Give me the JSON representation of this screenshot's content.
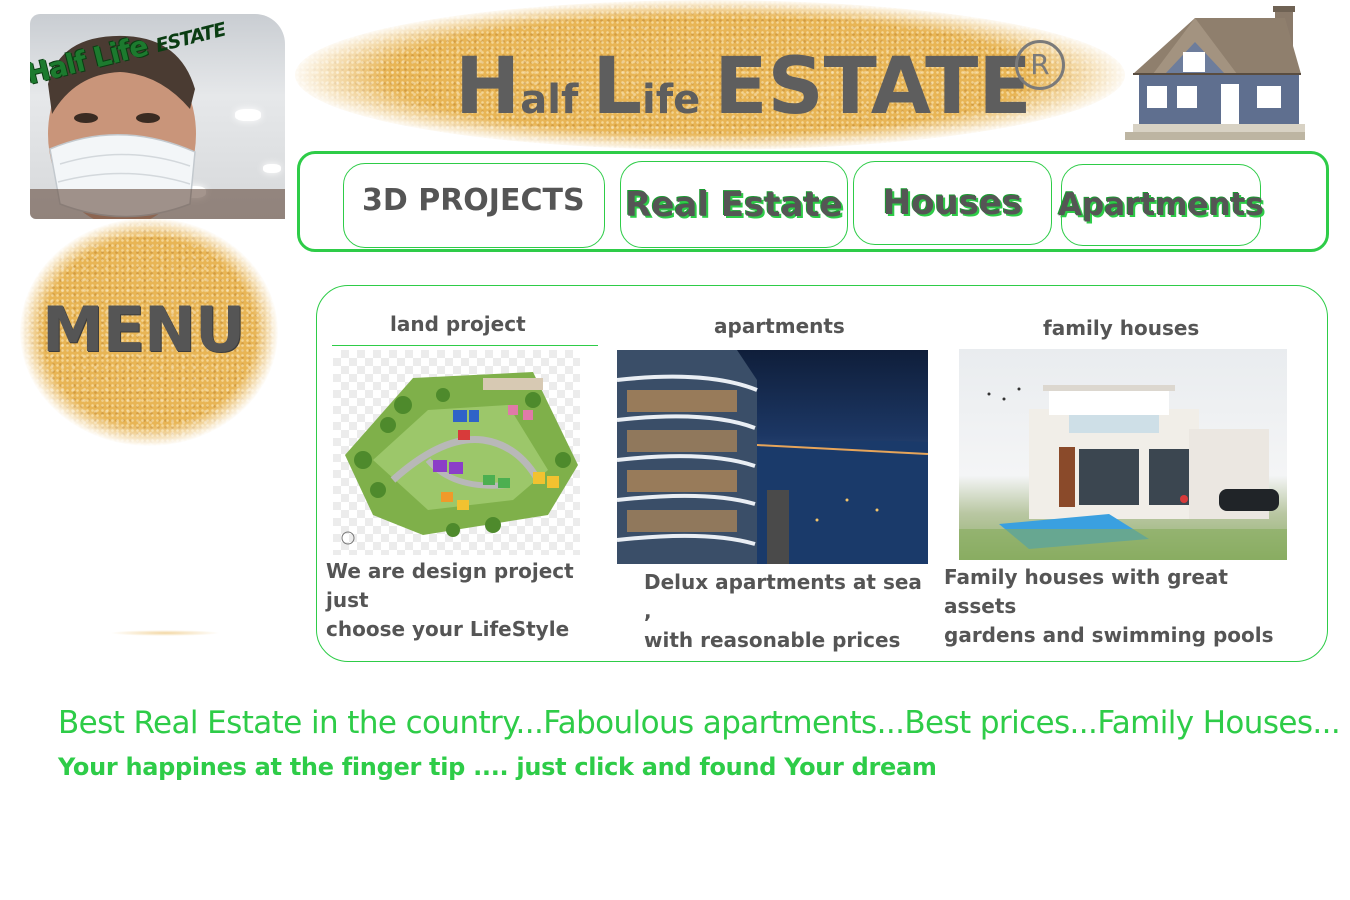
{
  "brand": {
    "avatar_text_main": "Half Life",
    "avatar_text_small": "ESTATE",
    "title_h": "H",
    "title_alf": "alf ",
    "title_l": "L",
    "title_ife": "ife ",
    "title_estate": "ESTATE",
    "registered_symbol": "R"
  },
  "nav": {
    "items": [
      {
        "label": "3D PROJECTS"
      },
      {
        "label": "Real Estate"
      },
      {
        "label": "Houses"
      },
      {
        "label": "Apartments"
      }
    ]
  },
  "sidebar": {
    "menu_label": "MENU"
  },
  "cards": [
    {
      "title": "land project",
      "desc_line1": "We are design project just",
      "desc_line2": "choose your LifeStyle"
    },
    {
      "title": "apartments",
      "desc_line1": "Delux apartments at sea ,",
      "desc_line2": "with reasonable prices"
    },
    {
      "title": "family houses",
      "desc_line1": "Family houses with great assets",
      "desc_line2": "gardens and swimming pools"
    }
  ],
  "footer": {
    "tagline": "Best Real Estate in the country...Faboulous apartments...Best prices...Family Houses...",
    "subtagline": "Your happines at the finger tip .... just click and found Your dream"
  },
  "colors": {
    "accent_green": "#2ecc48",
    "text_gray": "#555555",
    "sand": "#e8b555"
  },
  "icons": {
    "house": "house-illustration-icon",
    "registered": "registered-trademark-icon"
  }
}
